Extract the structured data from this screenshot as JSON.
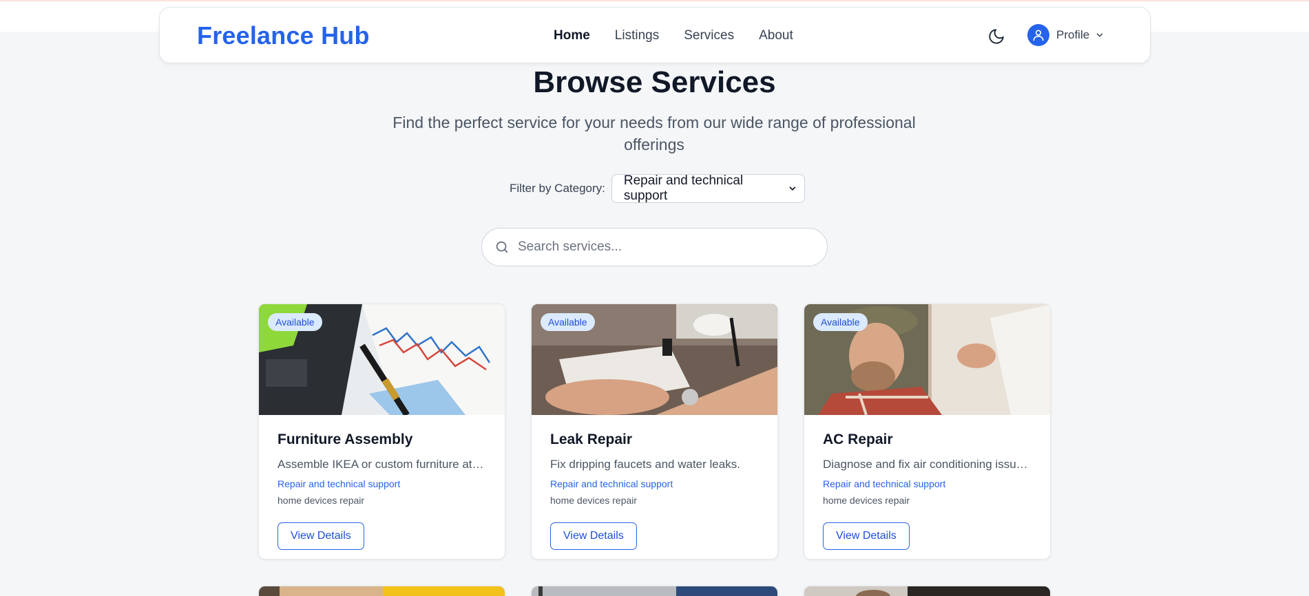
{
  "nav": {
    "brand": "Freelance Hub",
    "links": [
      "Home",
      "Listings",
      "Services",
      "About"
    ],
    "profile_label": "Profile"
  },
  "hero": {
    "title": "Browse Services",
    "subtitle": "Find the perfect service for your needs from our wide range of professional offerings"
  },
  "filter": {
    "label": "Filter by Category:",
    "selected": "Repair and technical support"
  },
  "search": {
    "placeholder": "Search services..."
  },
  "cards": [
    {
      "badge": "Available",
      "title": "Furniture Assembly",
      "description": "Assemble IKEA or custom furniture at home.",
      "category": "Repair and technical support",
      "subcategory": "home devices repair",
      "button": "View Details"
    },
    {
      "badge": "Available",
      "title": "Leak Repair",
      "description": "Fix dripping faucets and water leaks.",
      "category": "Repair and technical support",
      "subcategory": "home devices repair",
      "button": "View Details"
    },
    {
      "badge": "Available",
      "title": "AC Repair",
      "description": "Diagnose and fix air conditioning issues.",
      "category": "Repair and technical support",
      "subcategory": "home devices repair",
      "button": "View Details"
    }
  ],
  "colors": {
    "accent": "#2563eb",
    "badge_bg": "#dbeafe",
    "page_bg": "#f4f6f8"
  },
  "icons": [
    "moon-icon",
    "user-icon",
    "chevron-down-icon",
    "search-icon"
  ]
}
